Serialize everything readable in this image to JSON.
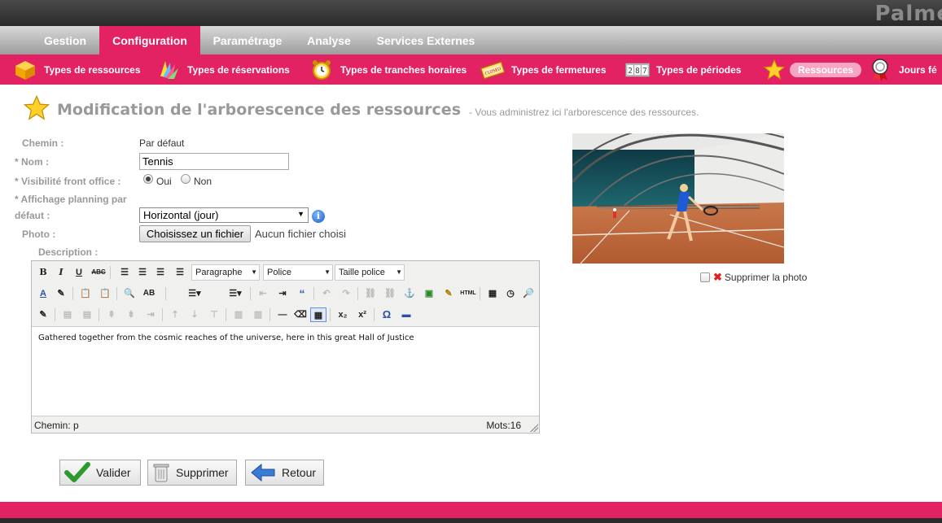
{
  "brand": "Palme",
  "main_nav": [
    "Gestion",
    "Configuration",
    "Paramétrage",
    "Analyse",
    "Services Externes"
  ],
  "sub_nav": [
    {
      "label": "Types de ressources",
      "icon": "box-icon"
    },
    {
      "label": "Types de réservations",
      "icon": "palette-icon"
    },
    {
      "label": "Types de tranches horaires",
      "icon": "alarm-clock-icon"
    },
    {
      "label": "Types de fermetures",
      "icon": "closed-ticket-icon"
    },
    {
      "label": "Types de périodes",
      "icon": "number-counter-icon"
    },
    {
      "label": "Ressources",
      "icon": "star-icon"
    },
    {
      "label": "Jours fé",
      "icon": "award-ribbon-icon"
    }
  ],
  "page": {
    "title": "Modification de l'arborescence des ressources",
    "subtitle": "- Vous administrez ici l'arborescence des ressources."
  },
  "form": {
    "chemin_label": "Chemin :",
    "chemin_value": "Par défaut",
    "nom_label": "* Nom :",
    "nom_value": "Tennis",
    "visibilite_label": "* Visibilité front office :",
    "oui": "Oui",
    "non": "Non",
    "affichage_label_1": "* Affichage planning par",
    "affichage_label_2": "défaut :",
    "affichage_value": "Horizontal (jour)",
    "photo_label": "Photo :",
    "file_button": "Choisissez un fichier",
    "file_status": "Aucun fichier choisi",
    "description_label": "Description :"
  },
  "editor": {
    "format_select": "Paragraphe",
    "font_select": "Police",
    "size_select": "Taille police",
    "content": "Gathered together from the cosmic reaches of the universe, here in this great Hall of Justice",
    "status_path": "Chemin: p",
    "word_count": "Mots:16"
  },
  "photo": {
    "delete_label": "Supprimer la photo"
  },
  "actions": {
    "validate": "Valider",
    "delete": "Supprimer",
    "back": "Retour"
  },
  "colors": {
    "accent": "#e32264",
    "title_gray": "#999999"
  }
}
